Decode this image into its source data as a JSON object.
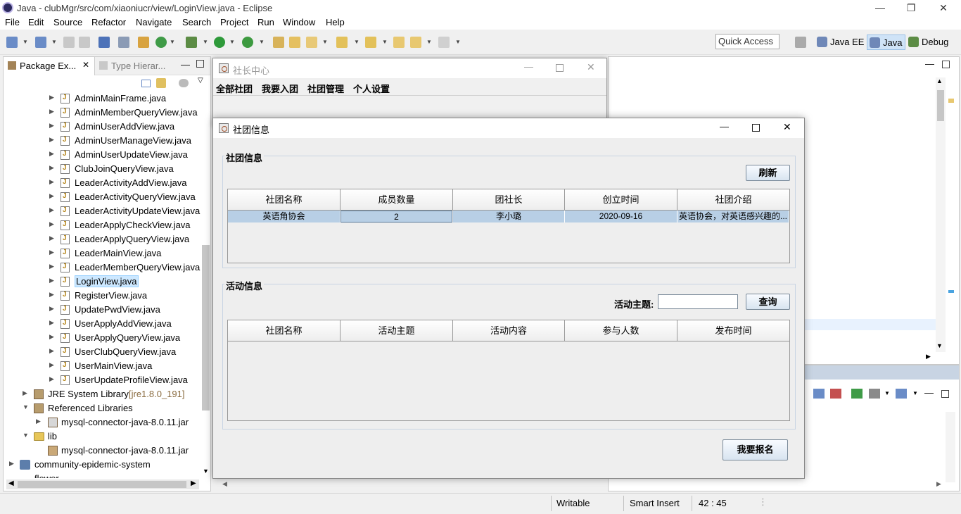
{
  "app": {
    "title": "Java - clubMgr/src/com/xiaoniucr/view/LoginView.java - Eclipse"
  },
  "window_controls": {
    "minimize": "—",
    "maximize": "❐",
    "close": "✕"
  },
  "menu": [
    "File",
    "Edit",
    "Source",
    "Refactor",
    "Navigate",
    "Search",
    "Project",
    "Run",
    "Window",
    "Help"
  ],
  "toolbar": {
    "quick_access": "Quick Access",
    "perspectives": [
      "Java EE",
      "Java",
      "Debug"
    ]
  },
  "package_explorer": {
    "tabs": [
      "Package Ex...",
      "Type Hierar..."
    ],
    "files": [
      "AdminMainFrame.java",
      "AdminMemberQueryView.java",
      "AdminUserAddView.java",
      "AdminUserManageView.java",
      "AdminUserUpdateView.java",
      "ClubJoinQueryView.java",
      "LeaderActivityAddView.java",
      "LeaderActivityQueryView.java",
      "LeaderActivityUpdateView.java",
      "LeaderApplyCheckView.java",
      "LeaderApplyQueryView.java",
      "LeaderMainView.java",
      "LeaderMemberQueryView.java",
      "LoginView.java",
      "RegisterView.java",
      "UpdatePwdView.java",
      "UserApplyAddView.java",
      "UserApplyQueryView.java",
      "UserClubQueryView.java",
      "UserMainView.java",
      "UserUpdateProfileView.java"
    ],
    "selected": "LoginView.java",
    "jre": "JRE System Library",
    "jre_version": "[jre1.8.0_191]",
    "ref_libs": "Referenced Libraries",
    "ref_jar": "mysql-connector-java-8.0.11.jar",
    "lib": "lib",
    "lib_jar": "mysql-connector-java-8.0.11.jar",
    "project1": "community-epidemic-system",
    "project2": "flower"
  },
  "status": {
    "writable": "Writable",
    "insert": "Smart Insert",
    "position": "42 : 45"
  },
  "leader_window": {
    "title": "社长中心",
    "menu": [
      "全部社团",
      "我要入团",
      "社团管理",
      "个人设置"
    ]
  },
  "club_window": {
    "title": "社团信息",
    "club_group": "社团信息",
    "refresh": "刷新",
    "club_columns": [
      "社团名称",
      "成员数量",
      "团社长",
      "创立时间",
      "社团介绍"
    ],
    "club_rows": [
      [
        "英语角协会",
        "2",
        "李小璐",
        "2020-09-16",
        "英语协会，对英语感兴趣的..."
      ]
    ],
    "activity_group": "活动信息",
    "activity_label": "活动主题:",
    "query": "查询",
    "activity_columns": [
      "社团名称",
      "活动主题",
      "活动内容",
      "参与人数",
      "发布时间"
    ],
    "signup": "我要报名"
  }
}
